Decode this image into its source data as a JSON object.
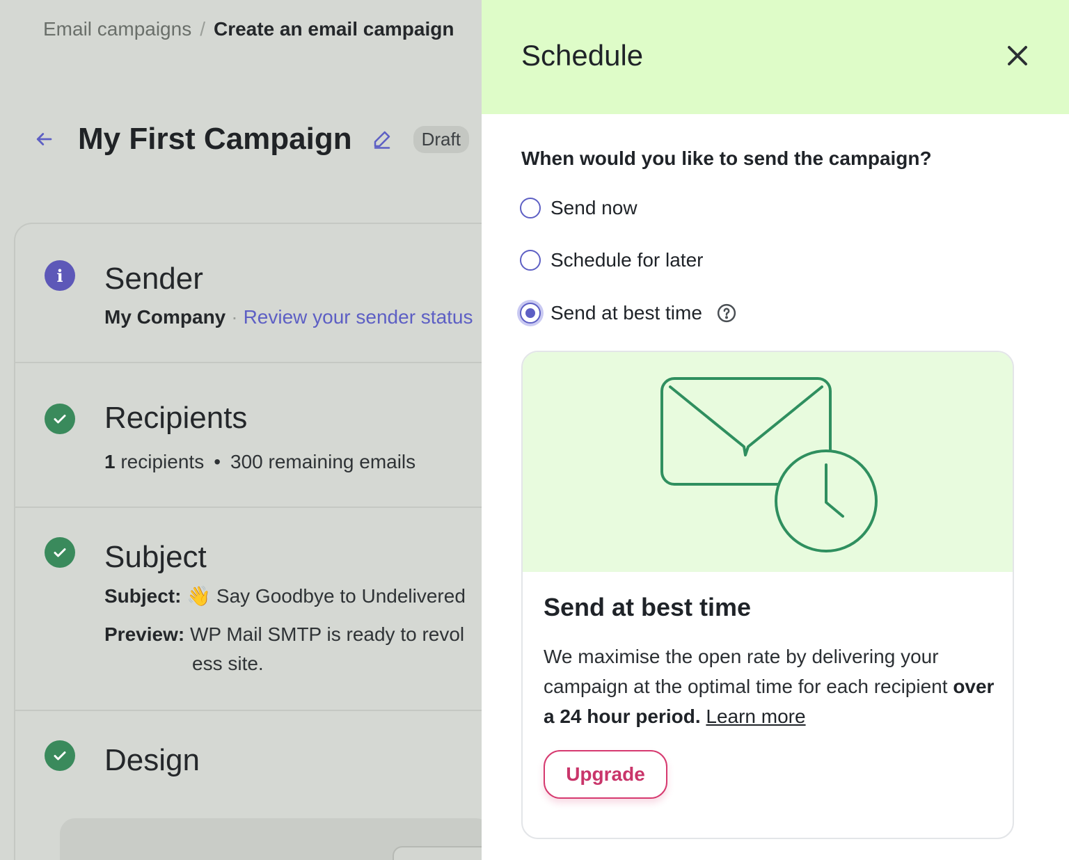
{
  "breadcrumb": {
    "parent": "Email campaigns",
    "separator": "/",
    "current": "Create an email campaign"
  },
  "campaign": {
    "title": "My First Campaign",
    "status_badge": "Draft"
  },
  "sections": {
    "sender": {
      "title": "Sender",
      "company": "My Company",
      "link": "Review your sender status",
      "icon": "info-icon"
    },
    "recipients": {
      "title": "Recipients",
      "count": "1",
      "count_label": "recipients",
      "separator": "•",
      "remaining": "300 remaining emails",
      "icon": "check-circle-icon"
    },
    "subject": {
      "title": "Subject",
      "subject_label": "Subject:",
      "subject_emoji": "👋",
      "subject_value": "Say Goodbye to Undelivered",
      "preview_label": "Preview:",
      "preview_value": "WP Mail SMTP is ready to revol",
      "preview_continued": "ess site.",
      "icon": "check-circle-icon"
    },
    "design": {
      "title": "Design",
      "icon": "check-circle-icon"
    }
  },
  "schedule_panel": {
    "title": "Schedule",
    "question": "When would you like to send the campaign?",
    "options": [
      {
        "label": "Send now",
        "checked": false
      },
      {
        "label": "Schedule for later",
        "checked": false
      },
      {
        "label": "Send at best time",
        "checked": true
      }
    ],
    "info_card": {
      "title": "Send at best time",
      "description": "We maximise the open rate by delivering your campaign at the optimal time for each recipient",
      "description_bold": "over a 24 hour period.",
      "learn_more": "Learn more",
      "upgrade_button": "Upgrade",
      "illustration": "envelope-clock-icon"
    }
  },
  "colors": {
    "accent": "#5d5fc4",
    "success": "#3a8a5c",
    "panel_header": "#defcc8",
    "illustration_bg": "#e8fbde",
    "illustration_stroke": "#2f8f5f",
    "upgrade": "#d6396f",
    "overlay_bg": "#d5d8d3"
  }
}
